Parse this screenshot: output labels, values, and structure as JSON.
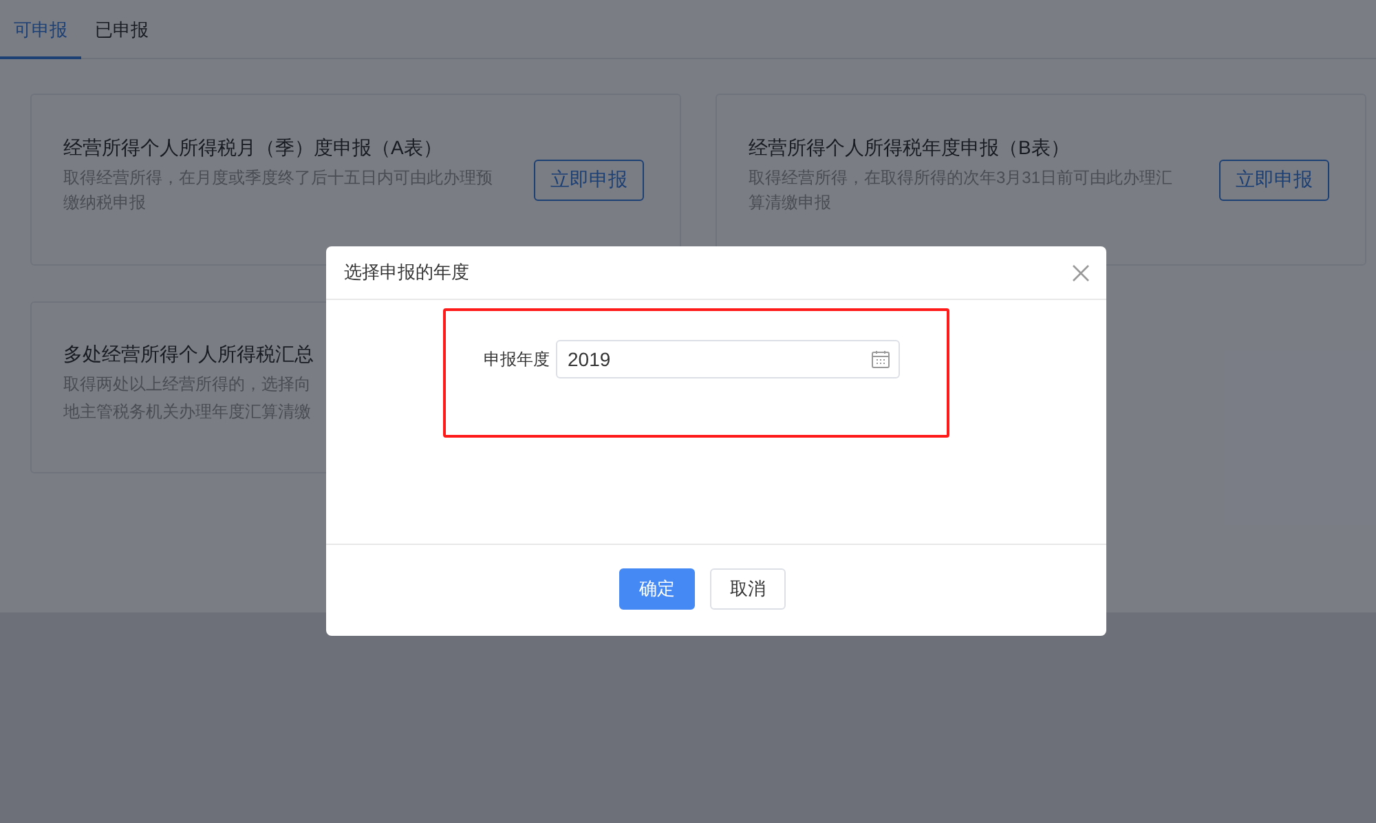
{
  "tabs": [
    {
      "label": "可申报",
      "selected": true
    },
    {
      "label": "已申报",
      "selected": false
    }
  ],
  "cards": [
    {
      "title": "经营所得个人所得税月（季）度申报（A表）",
      "description": "取得经营所得，在月度或季度终了后十五日内可由此办理预缴纳税申报",
      "button": "立即申报"
    },
    {
      "title": "经营所得个人所得税年度申报（B表）",
      "description": "取得经营所得，在取得所得的次年3月31日前可由此办理汇算清缴申报",
      "button": "立即申报"
    },
    {
      "title": "多处经营所得个人所得税汇总",
      "description_lines": [
        "取得两处以上经营所得的，选择向",
        "地主管税务机关办理年度汇算清缴"
      ]
    }
  ],
  "dialog": {
    "title": "选择申报的年度",
    "field": {
      "label": "申报年度",
      "value": "2019"
    },
    "buttons": [
      {
        "label": "确定",
        "kind": "primary"
      },
      {
        "label": "取消",
        "kind": "secondary"
      }
    ]
  }
}
